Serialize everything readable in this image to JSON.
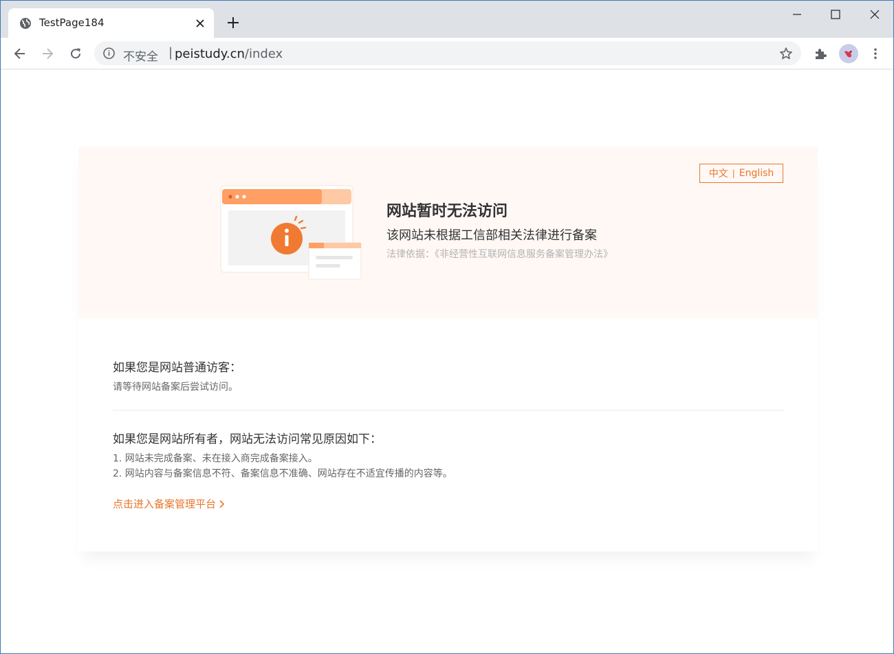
{
  "browser": {
    "tab_title": "TestPage184",
    "omnibox": {
      "security_label": "不安全",
      "separator": "|",
      "domain": "peistudy.cn",
      "path": "/index"
    }
  },
  "colors": {
    "accent": "#e8762c",
    "banner_bg": "#fff8f5",
    "window_border": "#3c78b4"
  },
  "icons": {
    "favicon": "globe-icon",
    "tab_close": "close-icon",
    "new_tab": "plus-icon",
    "back": "back-arrow-icon",
    "forward": "forward-arrow-icon",
    "reload": "reload-icon",
    "site_info": "info-icon",
    "bookmark": "star-icon",
    "extensions": "puzzle-icon",
    "menu": "kebab-menu-icon"
  },
  "page": {
    "lang_switch": {
      "zh": "中文",
      "divider": "|",
      "en": "English"
    },
    "headline": "网站暂时无法访问",
    "subline": "该网站未根据工信部相关法律进行备案",
    "legal": "法律依据：《非经营性互联网信息服务备案管理办法》",
    "visitor": {
      "title": "如果您是网站普通访客：",
      "text": "请等待网站备案后尝试访问。"
    },
    "owner": {
      "title": "如果您是网站所有者，网站无法访问常见原因如下：",
      "reasons": [
        "1. 网站未完成备案、未在接入商完成备案接入。",
        "2. 网站内容与备案信息不符、备案信息不准确、网站存在不适宜传播的内容等。"
      ]
    },
    "link_text": "点击进入备案管理平台"
  }
}
